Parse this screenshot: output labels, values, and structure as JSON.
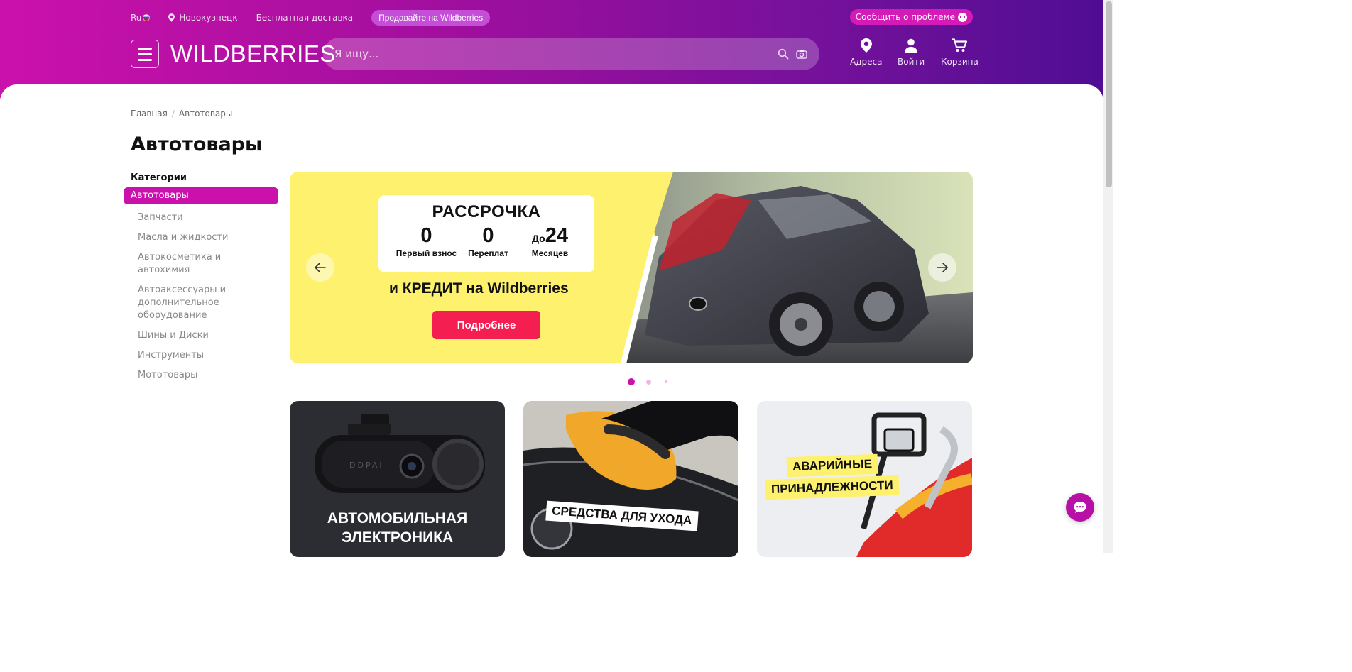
{
  "topbar": {
    "lang": "Ru",
    "city": "Новокузнецк",
    "delivery": "Бесплатная доставка",
    "sell_button": "Продавайте на Wildberries",
    "report_button": "Сообщить о проблеме"
  },
  "header": {
    "logo": "WILDBERRIES",
    "search_placeholder": "Я ищу...",
    "nav": {
      "addresses": "Адреса",
      "login": "Войти",
      "cart": "Корзина"
    }
  },
  "breadcrumb": {
    "home": "Главная",
    "current": "Автотовары"
  },
  "page_title": "Автотовары",
  "sidebar": {
    "title": "Категории",
    "active": "Автотовары",
    "items": [
      "Запчасти",
      "Масла и жидкости",
      "Автокосметика и автохимия",
      "Автоаксессуары и дополнительное оборудование",
      "Шины и Диски",
      "Инструменты",
      "Мототовары"
    ]
  },
  "banner": {
    "title": "РАССРОЧКА",
    "cols": [
      {
        "prefix": "",
        "num": "0",
        "label": "Первый взнос"
      },
      {
        "prefix": "",
        "num": "0",
        "label": "Переплат"
      },
      {
        "prefix": "До",
        "num": "24",
        "label": "Месяцев"
      }
    ],
    "subtitle": "и КРЕДИТ на Wildberries",
    "button": "Подробнее",
    "active_slide": 1,
    "slide_count": 3
  },
  "tiles": {
    "electronics": "АВТОМОБИЛЬНАЯ ЭЛЕКТРОНИКА",
    "camera_brand": "DDPAI",
    "care": "СРЕДСТВА ДЛЯ УХОДА",
    "emergency_1": "АВАРИЙНЫЕ",
    "emergency_2": "ПРИНАДЛЕЖНОСТИ"
  },
  "colors": {
    "brand": "#cb11ab",
    "brand_dark": "#4f0d94",
    "banner_yellow": "#fdf16e",
    "cta_red": "#f51e51"
  }
}
